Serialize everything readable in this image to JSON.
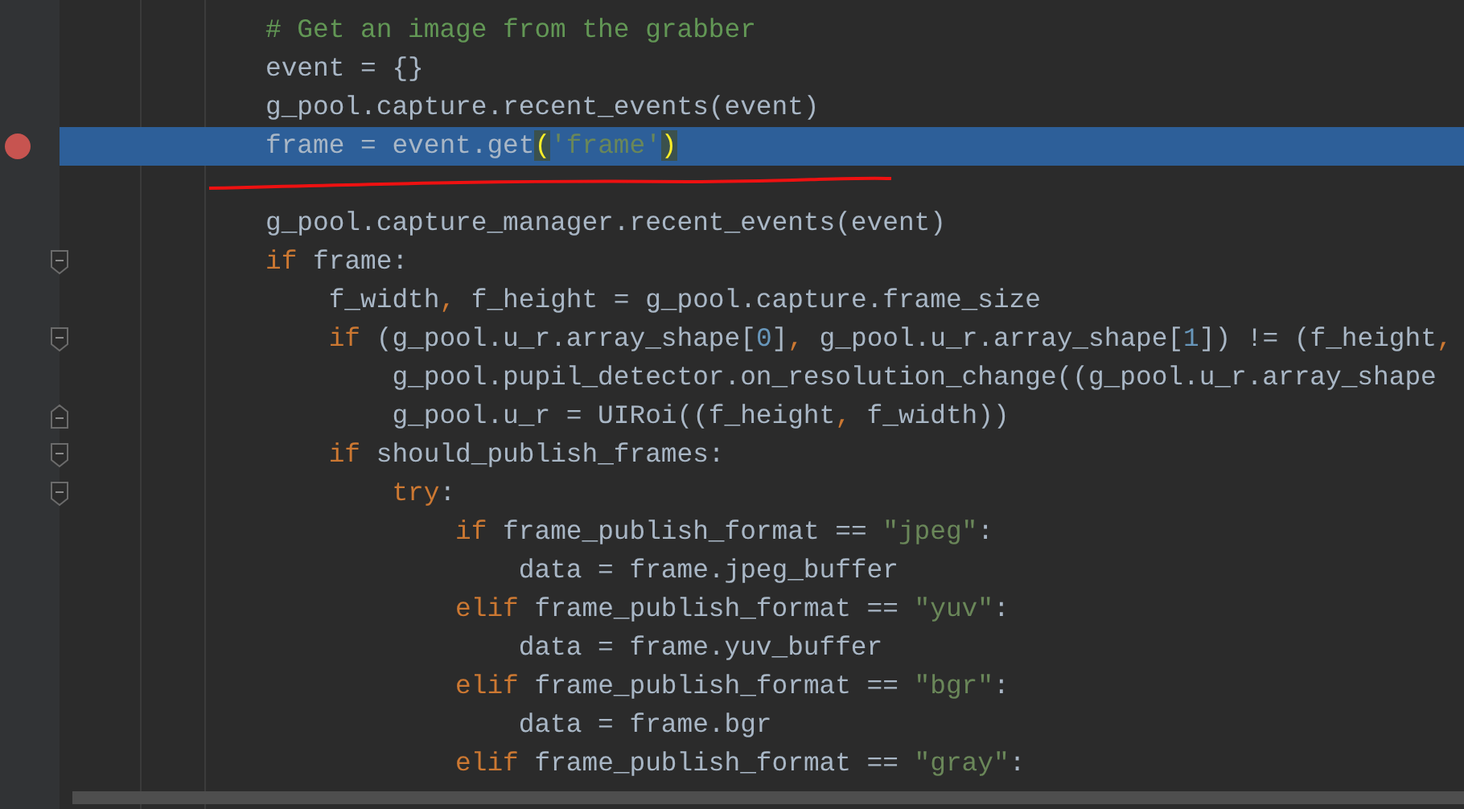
{
  "editor": {
    "lines": [
      {
        "tokens": [
          {
            "kind": "comment",
            "text": "# Get an image from the grabber"
          }
        ]
      },
      {
        "tokens": [
          {
            "kind": "plain",
            "text": "event = {}"
          }
        ]
      },
      {
        "tokens": [
          {
            "kind": "plain",
            "text": "g_pool.capture.recent_events(event)"
          }
        ]
      },
      {
        "breakpoint": true,
        "selected": true,
        "tokens": [
          {
            "kind": "plain",
            "text": "frame = event.get"
          },
          {
            "kind": "brace-match",
            "text": "("
          },
          {
            "kind": "string-match",
            "text": "'frame'"
          },
          {
            "kind": "brace-match",
            "text": ")"
          }
        ]
      },
      {
        "blank_line_before": true,
        "tokens": [
          {
            "kind": "plain",
            "text": "g_pool.capture_manager.recent_events(event)"
          }
        ]
      },
      {
        "fold_start": true,
        "tokens": [
          {
            "kind": "keyword",
            "text": "if"
          },
          {
            "kind": "plain",
            "text": " frame:"
          }
        ]
      },
      {
        "tokens": [
          {
            "kind": "plain",
            "text": "    f_width"
          },
          {
            "kind": "punct",
            "text": ","
          },
          {
            "kind": "plain",
            "text": " f_height = g_pool.capture.frame_size"
          }
        ]
      },
      {
        "fold_start": true,
        "tokens": [
          {
            "kind": "keyword",
            "text": "    if"
          },
          {
            "kind": "plain",
            "text": " (g_pool.u_r.array_shape["
          },
          {
            "kind": "number",
            "text": "0"
          },
          {
            "kind": "plain",
            "text": "]"
          },
          {
            "kind": "punct",
            "text": ","
          },
          {
            "kind": "plain",
            "text": " g_pool.u_r.array_shape["
          },
          {
            "kind": "number",
            "text": "1"
          },
          {
            "kind": "plain",
            "text": "]) != (f_height"
          },
          {
            "kind": "punct",
            "text": ","
          }
        ]
      },
      {
        "tokens": [
          {
            "kind": "plain",
            "text": "        g_pool.pupil_detector.on_resolution_change((g_pool.u_r.array_shape"
          }
        ]
      },
      {
        "fold_end": true,
        "tokens": [
          {
            "kind": "plain",
            "text": "        g_pool.u_r = UIRoi((f_height"
          },
          {
            "kind": "punct",
            "text": ","
          },
          {
            "kind": "plain",
            "text": " f_width))"
          }
        ]
      },
      {
        "fold_start": true,
        "tokens": [
          {
            "kind": "keyword",
            "text": "    if"
          },
          {
            "kind": "plain",
            "text": " should_publish_frames:"
          }
        ]
      },
      {
        "fold_start": true,
        "tokens": [
          {
            "kind": "keyword",
            "text": "        try"
          },
          {
            "kind": "plain",
            "text": ":"
          }
        ]
      },
      {
        "tokens": [
          {
            "kind": "keyword",
            "text": "            if"
          },
          {
            "kind": "plain",
            "text": " frame_publish_format == "
          },
          {
            "kind": "string",
            "text": "\"jpeg\""
          },
          {
            "kind": "plain",
            "text": ":"
          }
        ]
      },
      {
        "tokens": [
          {
            "kind": "plain",
            "text": "                data = frame.jpeg_buffer"
          }
        ]
      },
      {
        "tokens": [
          {
            "kind": "keyword",
            "text": "            elif"
          },
          {
            "kind": "plain",
            "text": " frame_publish_format == "
          },
          {
            "kind": "string",
            "text": "\"yuv\""
          },
          {
            "kind": "plain",
            "text": ":"
          }
        ]
      },
      {
        "tokens": [
          {
            "kind": "plain",
            "text": "                data = frame.yuv_buffer"
          }
        ]
      },
      {
        "tokens": [
          {
            "kind": "keyword",
            "text": "            elif"
          },
          {
            "kind": "plain",
            "text": " frame_publish_format == "
          },
          {
            "kind": "string",
            "text": "\"bgr\""
          },
          {
            "kind": "plain",
            "text": ":"
          }
        ]
      },
      {
        "tokens": [
          {
            "kind": "plain",
            "text": "                data = frame.bgr"
          }
        ]
      },
      {
        "tokens": [
          {
            "kind": "keyword",
            "text": "            elif"
          },
          {
            "kind": "plain",
            "text": " frame_publish_format == "
          },
          {
            "kind": "string",
            "text": "\"gray\""
          },
          {
            "kind": "plain",
            "text": ":"
          }
        ]
      }
    ]
  }
}
